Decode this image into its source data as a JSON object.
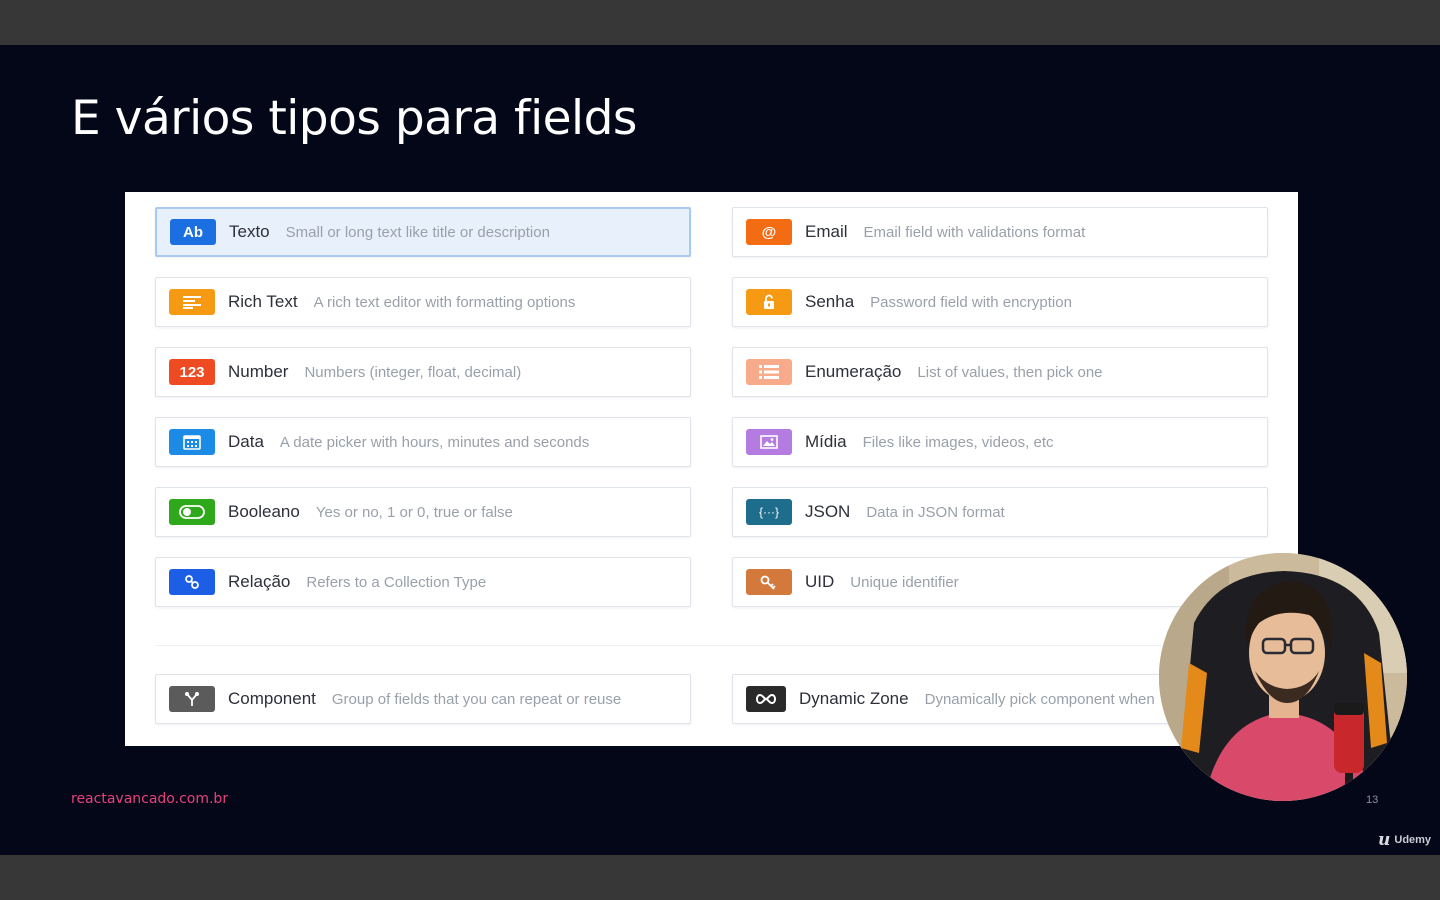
{
  "slide": {
    "title": "E vários tipos para fields",
    "footer_link": "reactavancado.com.br",
    "page_number": "13",
    "watermark": "Udemy"
  },
  "fields_left": [
    {
      "icon_text": "Ab",
      "icon_name": "text-icon",
      "name": "Texto",
      "desc": "Small or long text like title or description",
      "color": "#1c6fe0",
      "selected": true
    },
    {
      "icon_text": "",
      "icon_name": "rich-text-icon",
      "name": "Rich Text",
      "desc": "A rich text editor with formatting options",
      "color": "#f59a12"
    },
    {
      "icon_text": "123",
      "icon_name": "number-icon",
      "name": "Number",
      "desc": "Numbers (integer, float, decimal)",
      "color": "#ef4b23"
    },
    {
      "icon_text": "",
      "icon_name": "calendar-icon",
      "name": "Data",
      "desc": "A date picker with hours, minutes and seconds",
      "color": "#1c8be6"
    },
    {
      "icon_text": "",
      "icon_name": "toggle-icon",
      "name": "Booleano",
      "desc": "Yes or no, 1 or 0, true or false",
      "color": "#2fa81c"
    },
    {
      "icon_text": "",
      "icon_name": "relation-icon",
      "name": "Relação",
      "desc": "Refers to a Collection Type",
      "color": "#1d5ee6"
    }
  ],
  "fields_right": [
    {
      "icon_text": "@",
      "icon_name": "at-icon",
      "name": "Email",
      "desc": "Email field with validations format",
      "color": "#f36b12"
    },
    {
      "icon_text": "",
      "icon_name": "lock-icon",
      "name": "Senha",
      "desc": "Password field with encryption",
      "color": "#f59a12"
    },
    {
      "icon_text": "",
      "icon_name": "list-icon",
      "name": "Enumeração",
      "desc": "List of values, then pick one",
      "color": "#f7ab8a"
    },
    {
      "icon_text": "",
      "icon_name": "image-icon",
      "name": "Mídia",
      "desc": "Files like images, videos, etc",
      "color": "#b47be0"
    },
    {
      "icon_text": "{···}",
      "icon_name": "json-icon",
      "name": "JSON",
      "desc": "Data in JSON format",
      "color": "#1f6d8c"
    },
    {
      "icon_text": "",
      "icon_name": "key-icon",
      "name": "UID",
      "desc": "Unique identifier",
      "color": "#d3793c"
    }
  ],
  "field_component": {
    "icon_name": "component-icon",
    "name": "Component",
    "desc": "Group of fields that you can repeat or reuse",
    "color": "#5b5b5b"
  },
  "field_dynamic_zone": {
    "icon_name": "infinity-icon",
    "name": "Dynamic Zone",
    "desc": "Dynamically pick component when",
    "color": "#2a2a2a"
  }
}
